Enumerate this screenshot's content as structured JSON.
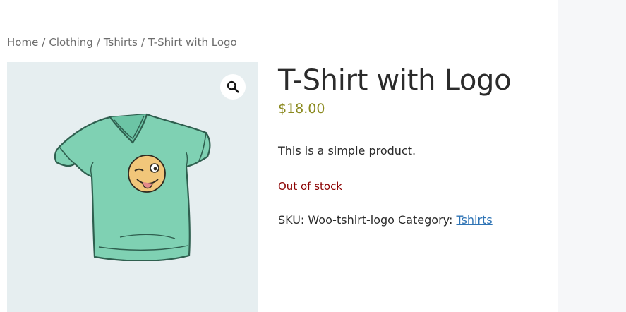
{
  "breadcrumb": {
    "items": [
      "Home",
      "Clothing",
      "Tshirts"
    ],
    "separator": "/",
    "current": "T-Shirt with Logo"
  },
  "product": {
    "title": "T-Shirt with Logo",
    "price": "$18.00",
    "description": "This is a simple product.",
    "stock_status": "Out of stock",
    "sku_label": "SKU:",
    "sku_value": "Woo-tshirt-logo",
    "category_label": "Category:",
    "category_value": "Tshirts"
  },
  "gallery": {
    "zoom_icon": "magnifier-icon",
    "image_subject": "t-shirt-with-logo-image"
  },
  "colors": {
    "price": "#8b8a1f",
    "out_of_stock": "#8b0000",
    "link": "#2f74b5",
    "gallery_bg": "#e6eef0",
    "shirt": "#7fd1b3",
    "logo_face": "#f1c67a"
  }
}
